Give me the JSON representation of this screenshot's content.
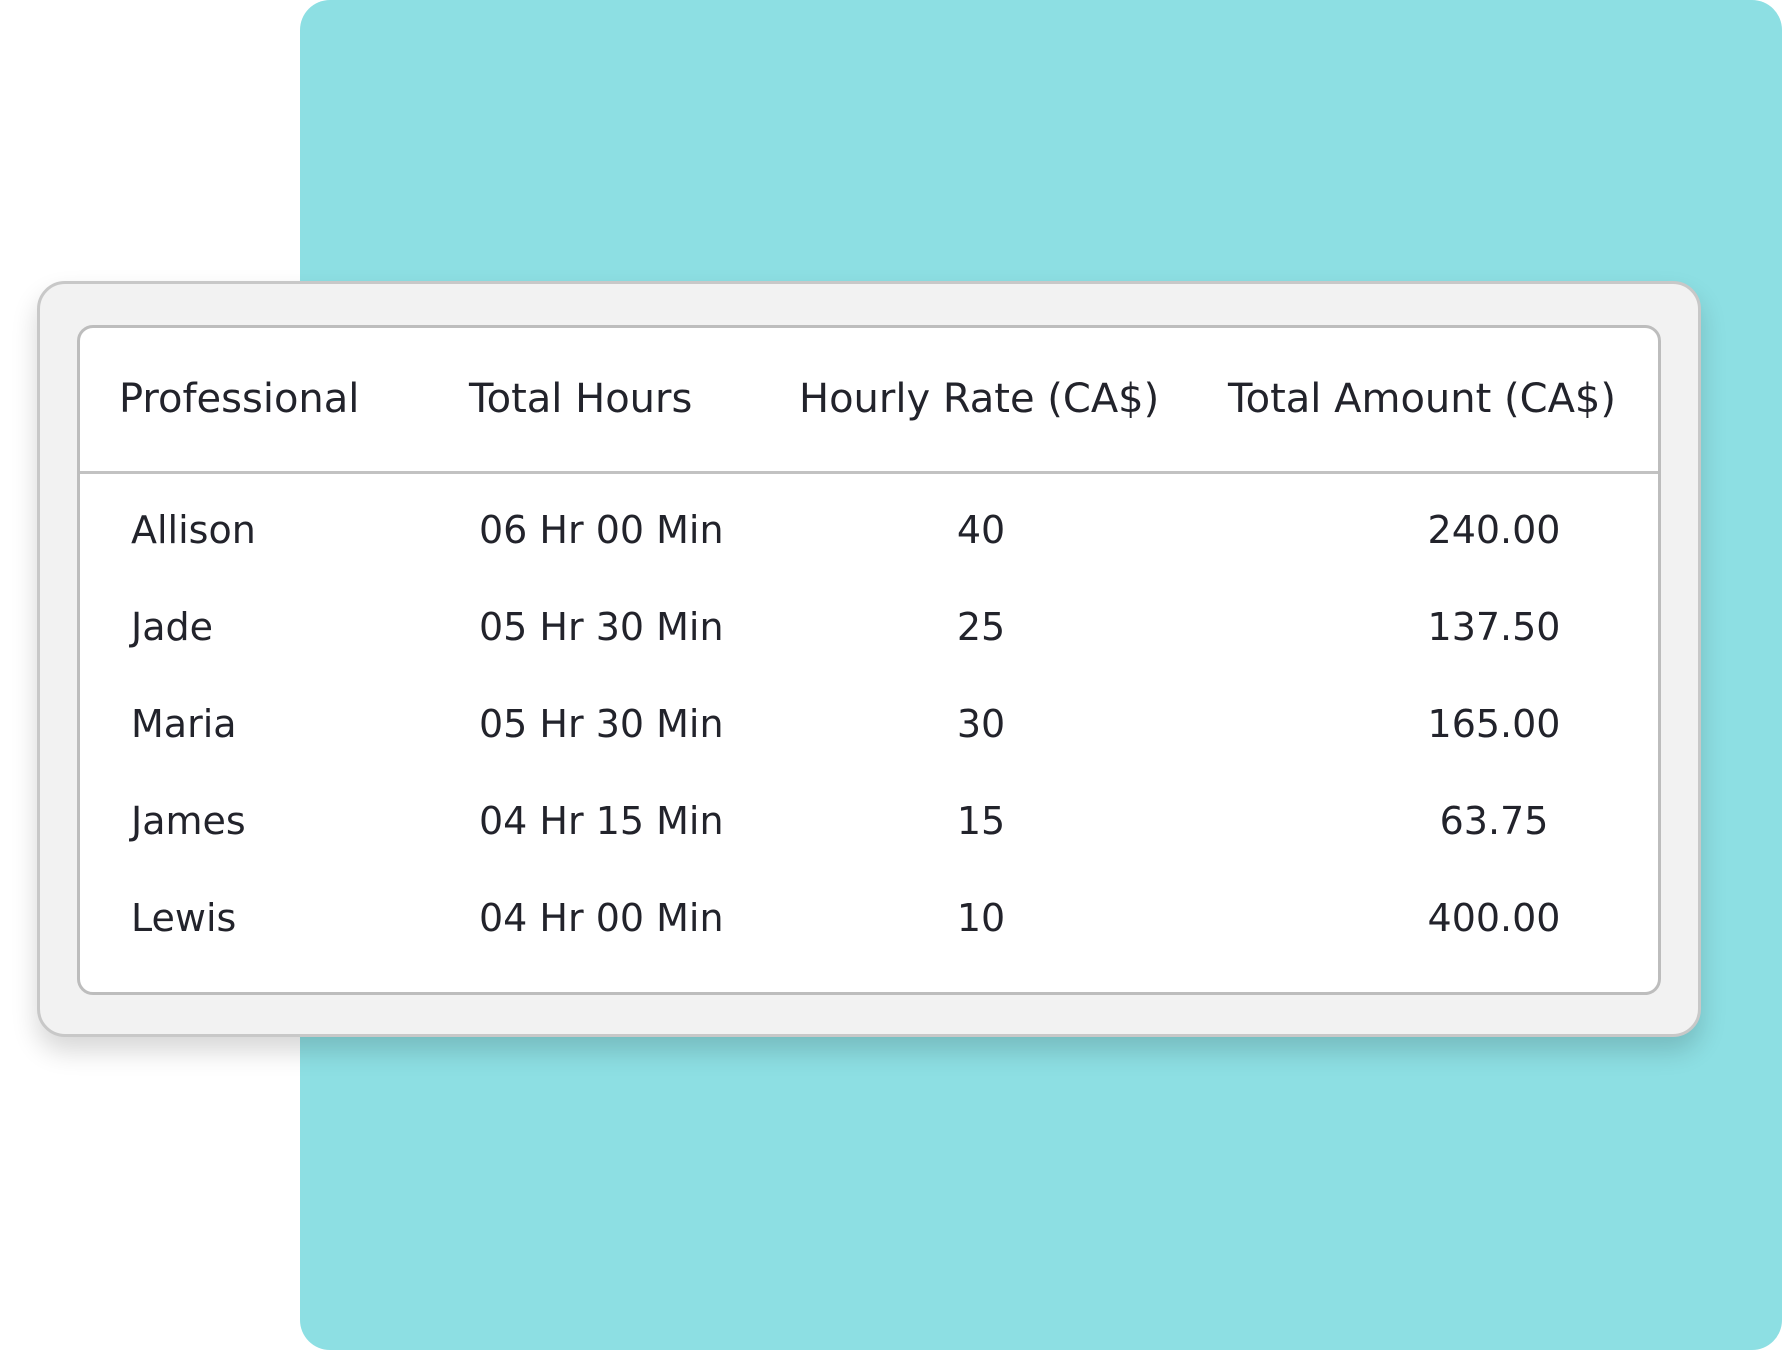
{
  "table": {
    "columns": [
      "Professional",
      "Total Hours",
      "Hourly Rate (CA$)",
      "Total Amount (CA$)"
    ],
    "rows": [
      {
        "professional": "Allison",
        "total_hours": "06 Hr 00 Min",
        "hourly_rate": "40",
        "total_amount": "240.00"
      },
      {
        "professional": "Jade",
        "total_hours": "05 Hr 30 Min",
        "hourly_rate": "25",
        "total_amount": "137.50"
      },
      {
        "professional": "Maria",
        "total_hours": "05 Hr 30 Min",
        "hourly_rate": "30",
        "total_amount": "165.00"
      },
      {
        "professional": "James",
        "total_hours": "04 Hr 15 Min",
        "hourly_rate": "15",
        "total_amount": "63.75"
      },
      {
        "professional": "Lewis",
        "total_hours": "04 Hr 00 Min",
        "hourly_rate": "10",
        "total_amount": "400.00"
      }
    ]
  },
  "colors": {
    "background": "#ffffff",
    "accent_panel": "#8ddfe3",
    "card_frame": "#f2f2f2",
    "text": "#22232b"
  }
}
